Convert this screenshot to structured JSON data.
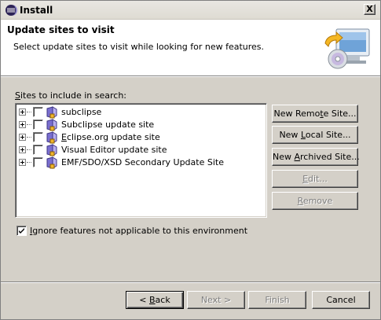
{
  "window": {
    "title": "Install",
    "close_glyph": "X"
  },
  "banner": {
    "title": "Update sites to visit",
    "description": "Select update sites to visit while looking for new features."
  },
  "sites": {
    "label_prefix": "",
    "label_mnemonic": "S",
    "label_rest": "ites to include in search:",
    "items": [
      {
        "label": "subclipse",
        "checked": false,
        "icon": "update-site-icon"
      },
      {
        "label": "Subclipse update site",
        "checked": false,
        "icon": "update-site-icon"
      },
      {
        "label_prefix": "",
        "label_mnemonic": "E",
        "label_rest": "clipse.org update site",
        "checked": false,
        "icon": "update-site-icon"
      },
      {
        "label": "Visual Editor update site",
        "checked": false,
        "icon": "update-site-icon"
      },
      {
        "label": "EMF/SDO/XSD Secondary Update Site",
        "checked": false,
        "icon": "update-site-icon"
      }
    ]
  },
  "side_buttons": {
    "new_remote": {
      "prefix": "New Remo",
      "mnemonic": "t",
      "rest": "e Site...",
      "enabled": true
    },
    "new_local": {
      "prefix": "New ",
      "mnemonic": "L",
      "rest": "ocal Site...",
      "enabled": true
    },
    "new_archived": {
      "prefix": "New ",
      "mnemonic": "A",
      "rest": "rchived Site...",
      "enabled": true
    },
    "edit": {
      "prefix": "",
      "mnemonic": "E",
      "rest": "dit...",
      "enabled": false
    },
    "remove": {
      "prefix": "",
      "mnemonic": "R",
      "rest": "emove",
      "enabled": false
    }
  },
  "ignore": {
    "prefix": "",
    "mnemonic": "I",
    "rest": "gnore features not applicable to this environment",
    "checked": true
  },
  "footer": {
    "back": {
      "prefix": "< ",
      "mnemonic": "B",
      "rest": "ack",
      "enabled": true
    },
    "next": {
      "label": "Next >",
      "enabled": false
    },
    "finish": {
      "label": "Finish",
      "enabled": false
    },
    "cancel": {
      "label": "Cancel",
      "enabled": true
    }
  }
}
